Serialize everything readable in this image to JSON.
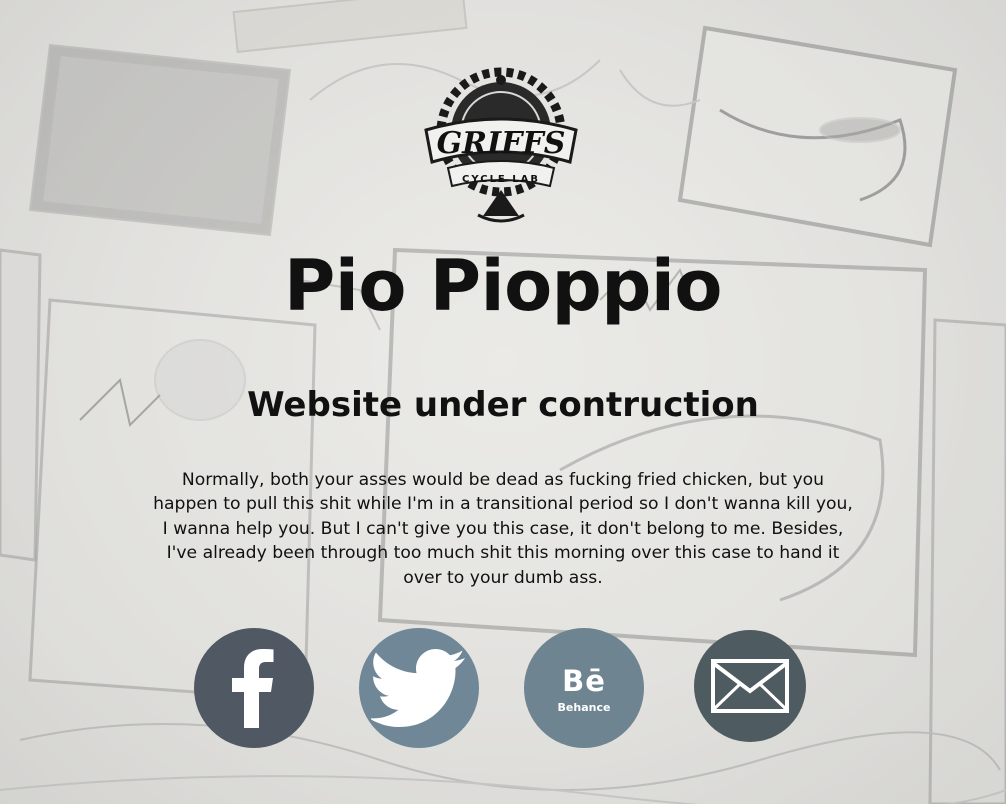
{
  "logo": {
    "text_main": "GRIFFS",
    "text_sub": "CYCLE LAB",
    "icon": "griffs-cycle-lab-logo"
  },
  "header": {
    "title": "Pio Pioppio",
    "subtitle": "Website under contruction"
  },
  "intro": {
    "text": "Normally, both your asses would be dead as fucking fried chicken, but you happen to pull this shit while I'm in a transitional period so I don't wanna kill you, I wanna help you. But I can't give you this case, it don't belong to me. Besides, I've already been through too much shit this morning over this case to hand it over to your dumb ass."
  },
  "social": {
    "facebook": {
      "icon": "facebook-icon",
      "color": "#505963"
    },
    "twitter": {
      "icon": "twitter-bird-icon",
      "color": "#6f8796"
    },
    "behance": {
      "icon": "behance-icon",
      "glyph": "Bē",
      "label": "Behance",
      "color": "#6e8591"
    },
    "email": {
      "icon": "envelope-icon",
      "color": "#4e5b60"
    }
  }
}
